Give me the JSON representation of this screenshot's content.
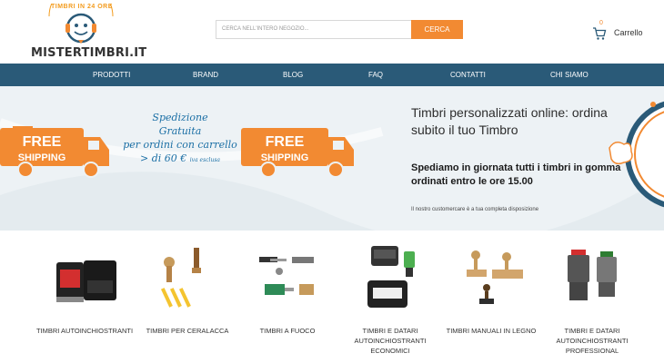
{
  "header": {
    "logo_text": "MISTERTIMBRI.IT",
    "logo_arc": "TIMBRI IN 24 ORE",
    "search": {
      "placeholder": "CERCA NELL'INTERO NEGOZIO...",
      "button": "CERCA"
    },
    "cart": {
      "count": "0",
      "label": "Carrello"
    }
  },
  "nav": [
    "PRODOTTI",
    "BRAND",
    "BLOG",
    "FAQ",
    "CONTATTI",
    "CHI SIAMO"
  ],
  "banner": {
    "free_shipping": [
      "FREE",
      "SHIPPING"
    ],
    "promo_lines": [
      "Spedizione",
      "Gratuita",
      "per ordini con carrello",
      "> di 60 €"
    ],
    "promo_small": "iva esclusa",
    "title": "Timbri personalizzati online: ordina subito il tuo Timbro",
    "bold": "Spediamo in giornata tutti i timbri in gomma ordinati entro le ore 15.00",
    "small": "Il nostro customercare è a tua completa disposizione"
  },
  "categories": [
    "TIMBRI AUTOINCHIOSTRANTI",
    "TIMBRI PER CERALACCA",
    "TIMBRI A FUOCO",
    "TIMBRI E DATARI AUTOINCHIOSTRANTI ECONOMICI",
    "TIMBRI MANUALI IN LEGNO",
    "TIMBRI E DATARI AUTOINCHIOSTRANTI PROFESSIONAL"
  ],
  "colors": {
    "accent": "#f28a32",
    "nav": "#2a5a78",
    "promo_blue": "#1b6fa5"
  }
}
